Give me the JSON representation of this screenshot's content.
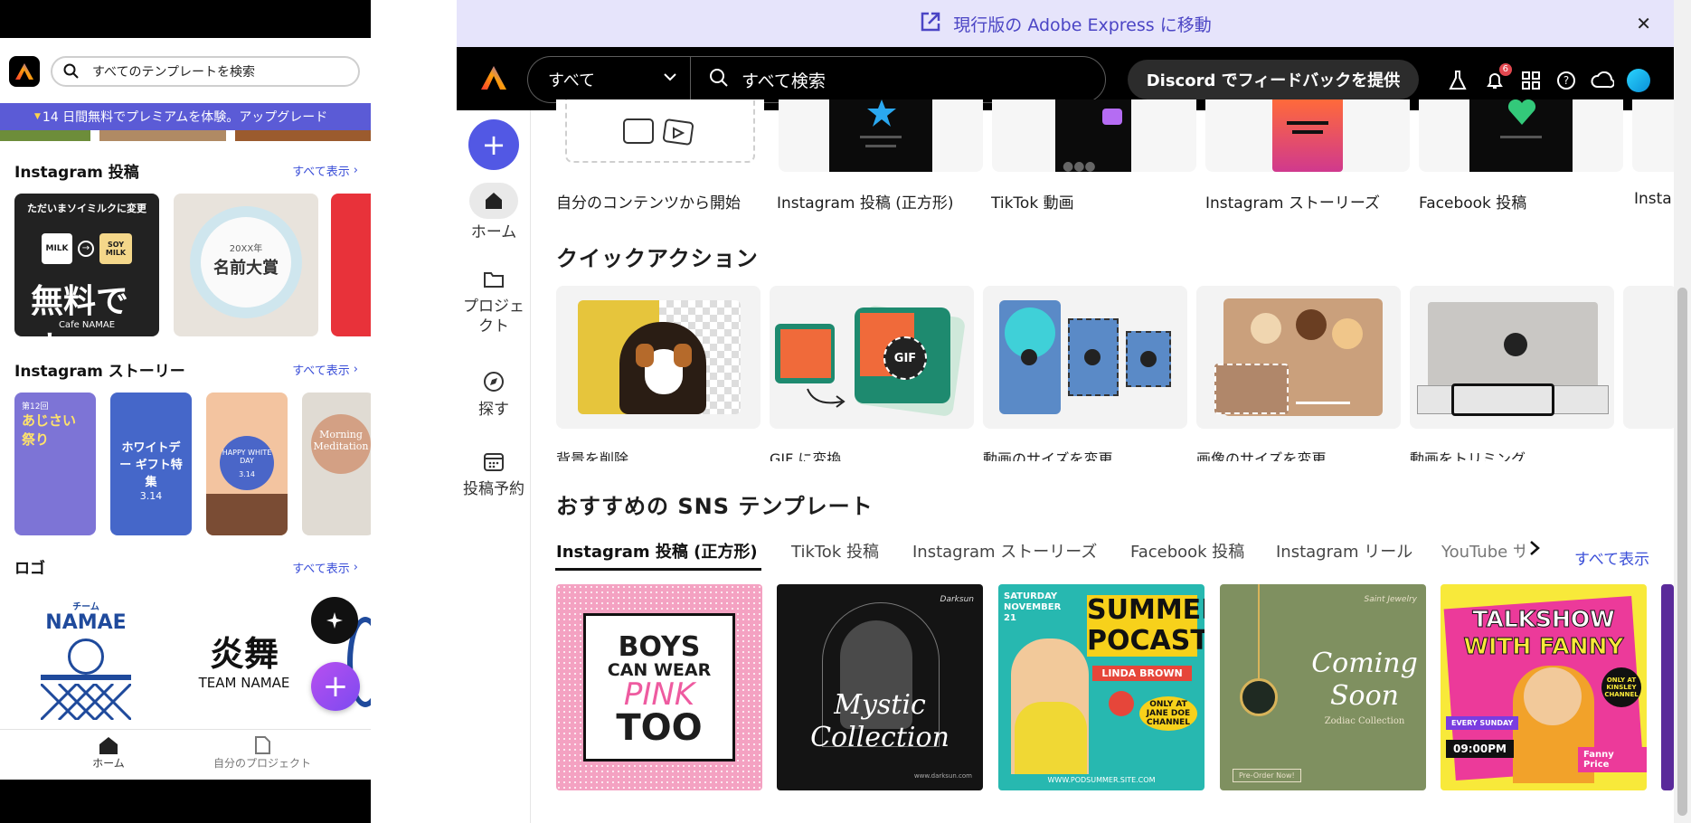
{
  "mobile": {
    "search_placeholder": "すべてのテンプレートを検索",
    "promo_text": "14 日間無料でプレミアムを体験。アップグレード",
    "sections": [
      {
        "title": "Instagram 投稿",
        "see_all": "すべて表示"
      },
      {
        "title": "Instagram ストーリー",
        "see_all": "すべて表示"
      },
      {
        "title": "ロゴ",
        "see_all": "すべて表示"
      }
    ],
    "ig_cards": [
      {
        "top": "ただいまソイミルクに変更",
        "milk": "MILK",
        "soy": "SOY MILK",
        "big": "無料です",
        "brand": "Cafe NAMAE"
      },
      {
        "small": "名前大賞",
        "year": "20XX年"
      }
    ],
    "story_cards": [
      {
        "title": "あじさい祭り",
        "no": "第12回"
      },
      {
        "title": "ホワイトデー ギフト特集",
        "date": "3.14"
      },
      {
        "title": "HAPPY WHITE DAY",
        "date": "3.14"
      },
      {
        "title": "Morning Meditation"
      }
    ],
    "logos": [
      {
        "top": "チーム",
        "name": "NAMAE"
      },
      {
        "name": "炎舞",
        "sub": "TEAM NAMAE"
      }
    ],
    "tabbar": {
      "home": "ホーム",
      "projects": "自分のプロジェクト"
    }
  },
  "desktop": {
    "banner_text": "現行版の Adobe Express に移動",
    "topbar": {
      "scope": "すべて",
      "search_placeholder": "すべて検索",
      "discord_button": "Discord でフィードバックを提供",
      "notification_count": "6"
    },
    "rail": {
      "home": "ホーム",
      "projects": "プロジェクト",
      "discover": "探す",
      "schedule": "投稿予約"
    },
    "templates": [
      "自分のコンテンツから開始",
      "Instagram 投稿 (正方形)",
      "TikTok 動画",
      "Instagram ストーリーズ",
      "Facebook 投稿",
      "Insta"
    ],
    "quick_actions_title": "クイックアクション",
    "quick_actions": [
      "背景を削除",
      "GIF に変換",
      "動画のサイズを変更",
      "画像のサイズを変更",
      "動画をトリミング"
    ],
    "sns_title": "おすすめの SNS テンプレート",
    "sns_tabs": [
      "Instagram 投稿 (正方形)",
      "TikTok 投稿",
      "Instagram ストーリーズ",
      "Facebook 投稿",
      "Instagram リール",
      "YouTube サ"
    ],
    "sns_see_all": "すべて表示",
    "sns_cards": [
      {
        "line1": "BOYS",
        "line2": "CAN WEAR",
        "line3": "PINK",
        "line4": "TOO"
      },
      {
        "brand": "Darksun",
        "line1": "Mystic",
        "line2": "Collection",
        "footer": "www.darksun.com"
      },
      {
        "date": "SATURDAY NOVEMBER 21",
        "title1": "SUMMER",
        "title2": "POCAST",
        "guest": "LINDA BROWN",
        "footer": "WWW.PODSUMMER.SITE.COM",
        "badge": "ONLY AT JANE DOE CHANNEL"
      },
      {
        "brand": "Saint Jewelry",
        "line1": "Coming",
        "line2": "Soon",
        "sub": "Zodiac Collection",
        "pre": "Pre-Order Now!"
      },
      {
        "title1": "TALKSHOW",
        "title2": "WITH FANNY",
        "day": "EVERY SUNDAY",
        "time": "09:00PM",
        "price": "Fanny Price",
        "badge": "ONLY AT KINSLEY CHANNEL"
      }
    ]
  },
  "colors": {
    "accent": "#5258e4",
    "banner_bg": "#e6e4fb",
    "promo_bg": "#5b5bd6",
    "link": "#3b4fd8"
  }
}
